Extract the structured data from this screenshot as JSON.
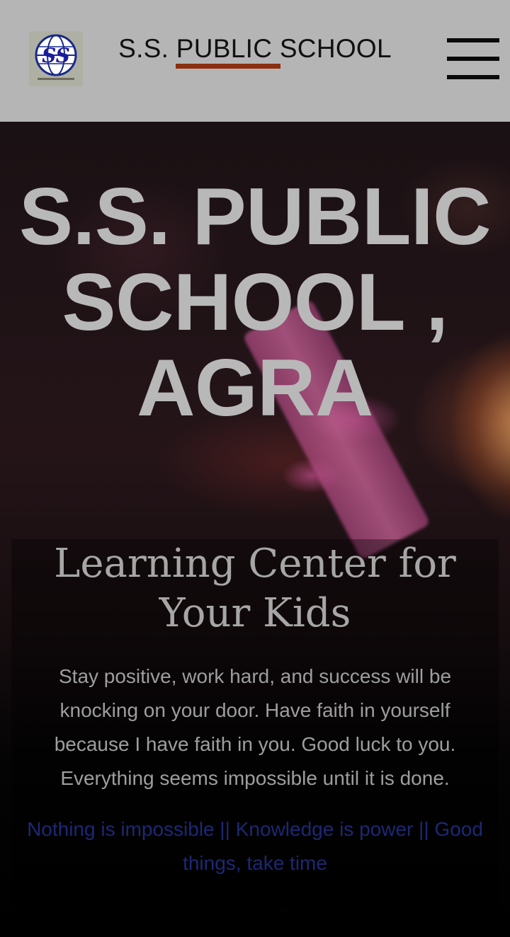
{
  "header": {
    "logo_icon": "school-globe-logo",
    "logo_initials": "SS",
    "title": "S.S. PUBLIC SCHOOL",
    "menu_icon": "hamburger-menu-icon"
  },
  "hero": {
    "title_lines": [
      "S.S. PUBLIC",
      "SCHOOL ,",
      "AGRA"
    ],
    "subtitle_lines": [
      "Learning Center for",
      "Your Kids"
    ],
    "paragraph": "Stay positive, work hard, and success will be knocking on your door. Have faith in yourself because I have faith in you. Good luck to you. Everything seems impossible until it is done.",
    "link_text": "Nothing is impossible || Knowledge is power || Good things, take time"
  },
  "colors": {
    "header_bg": "#b5b5b5",
    "underline_accent": "#8c2f10",
    "link_color": "#1d2873"
  }
}
